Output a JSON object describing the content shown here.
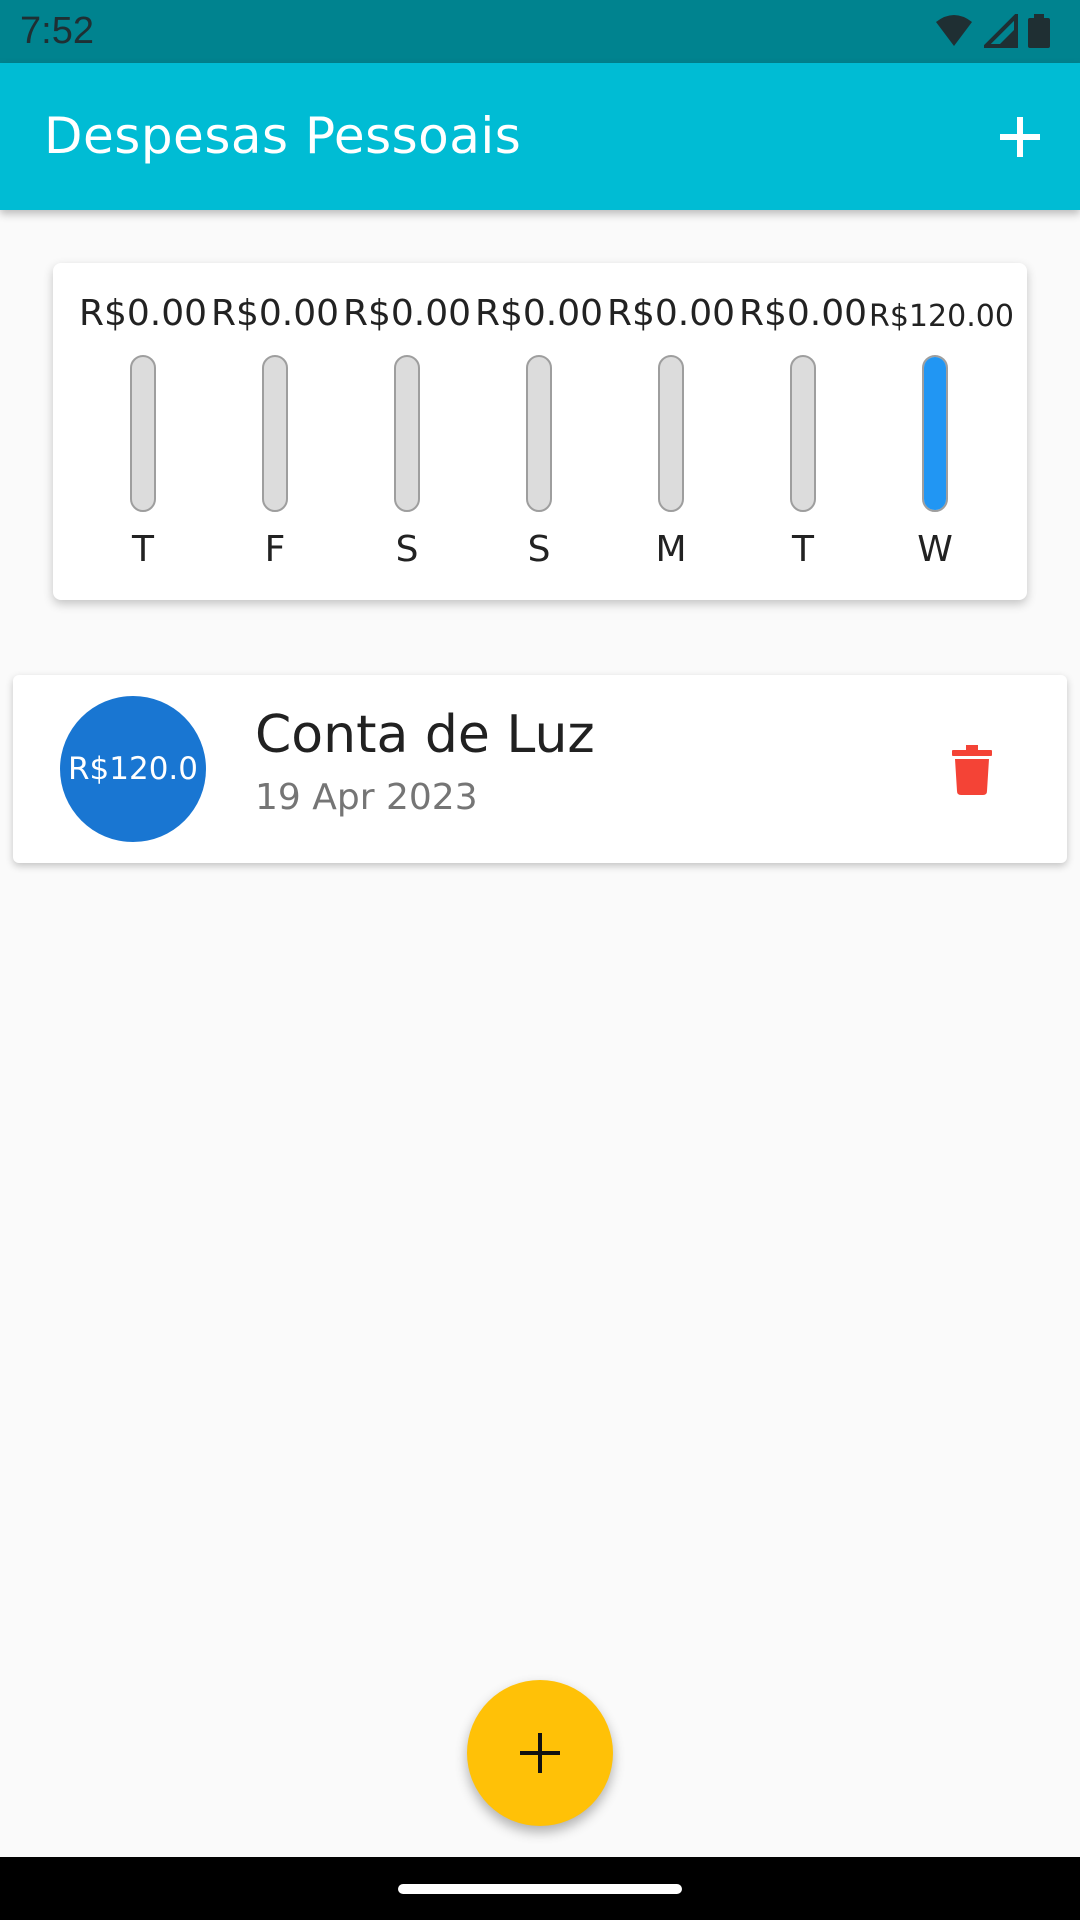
{
  "status_bar": {
    "time": "7:52",
    "icons": [
      "wifi-icon",
      "cell-signal-icon",
      "battery-icon"
    ]
  },
  "app_bar": {
    "title": "Despesas Pessoais",
    "add_icon": "plus-icon"
  },
  "chart_data": {
    "type": "bar",
    "categories": [
      "T",
      "F",
      "S",
      "S",
      "M",
      "T",
      "W"
    ],
    "values": [
      0,
      0,
      0,
      0,
      0,
      0,
      120
    ],
    "value_labels": [
      "R$0.00",
      "R$0.00",
      "R$0.00",
      "R$0.00",
      "R$0.00",
      "R$0.00",
      "R$120.00"
    ],
    "fill_fraction": [
      0,
      0,
      0,
      0,
      0,
      0,
      1
    ],
    "colors": {
      "fill": "#2196f3",
      "track": "#dcdcdc"
    }
  },
  "transactions": [
    {
      "amount": "R$120.0",
      "title": "Conta de Luz",
      "date": "19 Apr 2023",
      "delete_icon": "trash-icon"
    }
  ],
  "fab": {
    "icon": "plus-icon",
    "color": "#ffc107"
  },
  "colors": {
    "primary": "#00bcd4",
    "primary_dark": "#00838f",
    "avatar": "#1976d2",
    "delete": "#f44336"
  }
}
